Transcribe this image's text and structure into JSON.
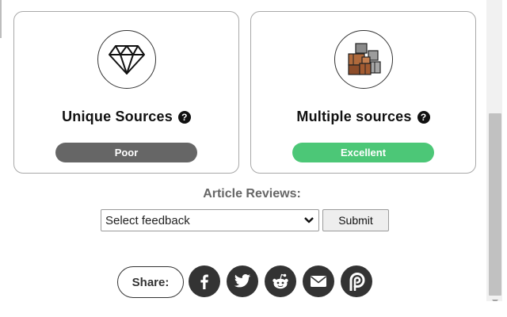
{
  "cards": [
    {
      "title": "Unique Sources",
      "rating": "Poor",
      "icon": "diamond-icon"
    },
    {
      "title": "Multiple sources",
      "rating": "Excellent",
      "icon": "boxes-stack-icon"
    }
  ],
  "help_glyph": "?",
  "reviews": {
    "label": "Article Reviews:",
    "select_value": "Select feedback",
    "submit_label": "Submit"
  },
  "share": {
    "label": "Share:",
    "icons": [
      "facebook-icon",
      "twitter-icon",
      "reddit-icon",
      "email-icon",
      "parler-icon"
    ]
  },
  "colors": {
    "poor": "#666666",
    "excellent": "#4cc777",
    "social_bg": "#333333"
  }
}
